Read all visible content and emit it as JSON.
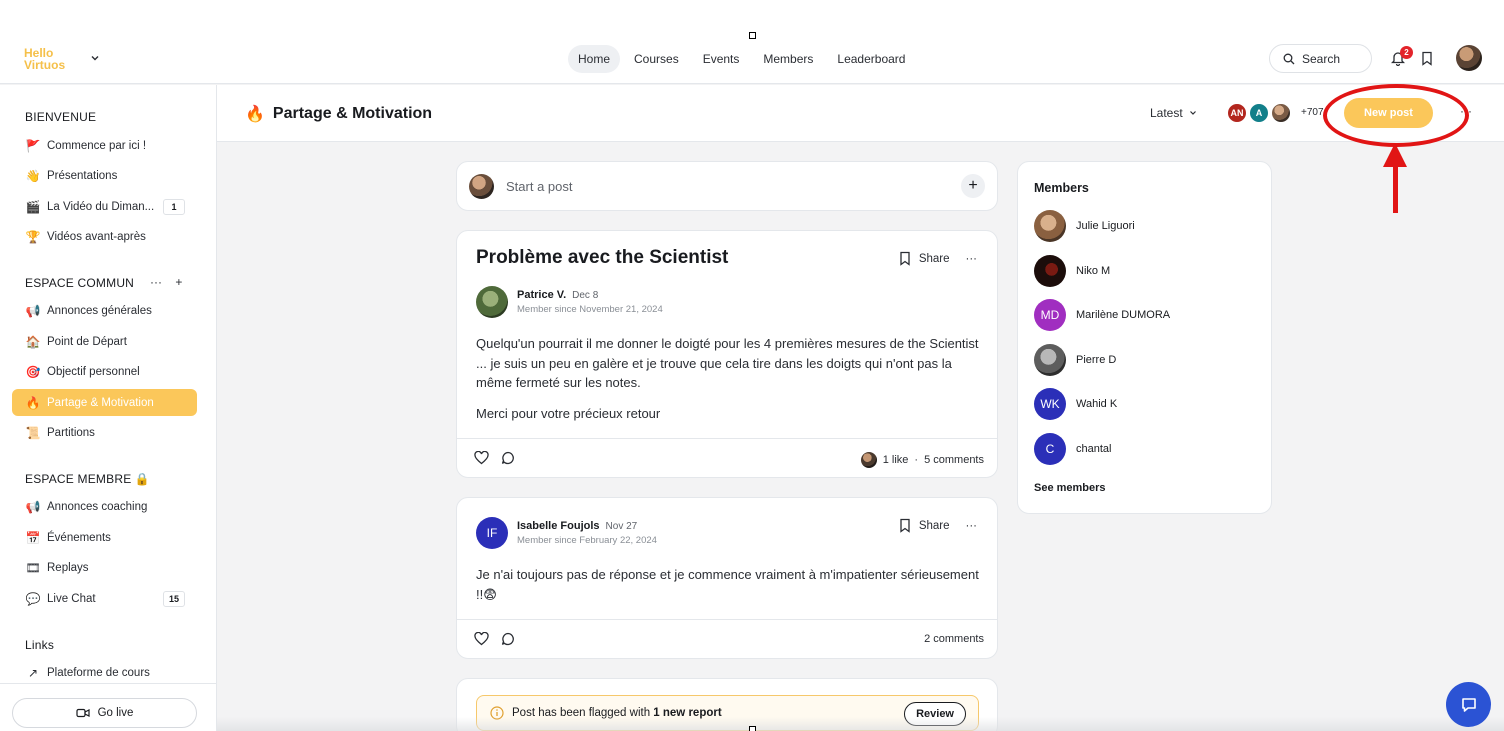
{
  "logo": {
    "line1": "Hello",
    "line2": "Virtuos"
  },
  "nav": [
    "Home",
    "Courses",
    "Events",
    "Members",
    "Leaderboard"
  ],
  "search": {
    "label": "Search"
  },
  "notifications": {
    "count": "2"
  },
  "sidebar": {
    "sections": [
      {
        "title": "BIENVENUE",
        "items": [
          {
            "icon": "🚩",
            "label": "Commence par ici !"
          },
          {
            "icon": "👋",
            "label": "Présentations"
          },
          {
            "icon": "🎬",
            "label": "La Vidéo du Diman...",
            "count": "1"
          },
          {
            "icon": "🏆",
            "label": "Vidéos avant-après"
          }
        ]
      },
      {
        "title": "ESPACE COMMUN",
        "items": [
          {
            "icon": "📢",
            "label": "Annonces générales"
          },
          {
            "icon": "🏠",
            "label": "Point de Départ"
          },
          {
            "icon": "🎯",
            "label": "Objectif personnel"
          },
          {
            "icon": "🔥",
            "label": "Partage & Motivation"
          },
          {
            "icon": "📜",
            "label": "Partitions"
          }
        ]
      },
      {
        "title": "ESPACE MEMBRE 🔒",
        "items": [
          {
            "icon": "📢",
            "label": "Annonces coaching"
          },
          {
            "icon": "📅",
            "label": "Événements"
          },
          {
            "icon": "🎞",
            "label": "Replays"
          },
          {
            "icon": "💬",
            "label": "Live Chat",
            "count": "15"
          }
        ]
      },
      {
        "title": "Links",
        "items": [
          {
            "icon": "↗",
            "label": "Plateforme de cours"
          }
        ]
      }
    ],
    "go_live": "Go live"
  },
  "space": {
    "icon": "🔥",
    "title": "Partage & Motivation",
    "sort": "Latest",
    "avatars": [
      {
        "initials": "AN",
        "color": "#b3261e"
      },
      {
        "initials": "A",
        "color": "#127f8a"
      }
    ],
    "extra_members": "+707",
    "new_post": "New post"
  },
  "composer": {
    "placeholder": "Start a post"
  },
  "posts": [
    {
      "title": "Problème avec the Scientist",
      "share": "Share",
      "author": "Patrice V.",
      "date": "Dec 8",
      "member_since": "Member since November 21, 2024",
      "body": [
        "Quelqu'un pourrait il me donner le doigté pour les 4 premières mesures de the Scientist ...  je suis un peu en galère et je trouve que cela tire dans les doigts qui n'ont pas la même fermeté sur les notes.",
        "Merci pour votre précieux retour"
      ],
      "likes": "1 like",
      "comments": "5 comments"
    },
    {
      "share": "Share",
      "author": "Isabelle Foujols",
      "initials": "IF",
      "date": "Nov 27",
      "member_since": "Member since February 22, 2024",
      "body": [
        "Je n'ai toujours pas de réponse et je commence vraiment à m'impatienter sérieusement !!😨"
      ],
      "comments": "2 comments"
    }
  ],
  "flag": {
    "text_prefix": "Post has been flagged with ",
    "text_bold": "1 new report",
    "review": "Review"
  },
  "members_widget": {
    "title": "Members",
    "list": [
      {
        "name": "Julie Liguori"
      },
      {
        "name": "Niko M"
      },
      {
        "name": "Marilène DUMORA",
        "initials": "MD",
        "color": "#a02ec0"
      },
      {
        "name": "Pierre D"
      },
      {
        "name": "Wahid K",
        "initials": "WK",
        "color": "#2b2fb8"
      },
      {
        "name": "chantal",
        "initials": "C",
        "color": "#2b2fb8"
      }
    ],
    "see_all": "See members"
  }
}
